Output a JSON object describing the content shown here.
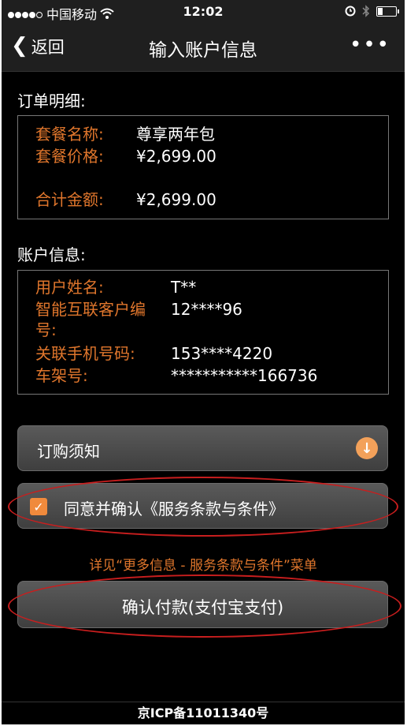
{
  "status_bar": {
    "carrier": "中国移动",
    "wifi_icon": "wifi-icon",
    "time": "12:02",
    "alarm_icon": "alarm-icon",
    "bluetooth_icon": "bluetooth-icon",
    "battery_level": 0.25
  },
  "nav": {
    "back_label": "返回",
    "title": "输入账户信息",
    "more_label": "•••"
  },
  "order": {
    "section_title": "订单明细:",
    "package_name_label": "套餐名称:",
    "package_name_value": "尊享两年包",
    "package_price_label": "套餐价格:",
    "package_price_value": "¥2,699.00",
    "total_label": "合计金额:",
    "total_value": "¥2,699.00"
  },
  "account": {
    "section_title": "账户信息:",
    "username_label": "用户姓名:",
    "username_value": "T**",
    "customer_no_label_1": "智能互联客户编",
    "customer_no_label_2": "号:",
    "customer_no_value": "12****96",
    "phone_label": "关联手机号码:",
    "phone_value": "153****4220",
    "vin_label": "车架号:",
    "vin_value": "***********166736"
  },
  "order_notice": {
    "label": "订购须知",
    "icon": "arrow-down-circle-icon"
  },
  "agreement": {
    "label": "同意并确认《服务条款与条件》",
    "checked": true
  },
  "hint": "详见“更多信息 - 服务条款与条件”菜单",
  "pay_button": {
    "label": "确认付款(支付宝支付)"
  },
  "footer": {
    "icp": "京ICP备11011340号"
  },
  "colors": {
    "accent_orange": "#e0762c",
    "annotation_red": "#c81e1e",
    "background": "#000000"
  }
}
